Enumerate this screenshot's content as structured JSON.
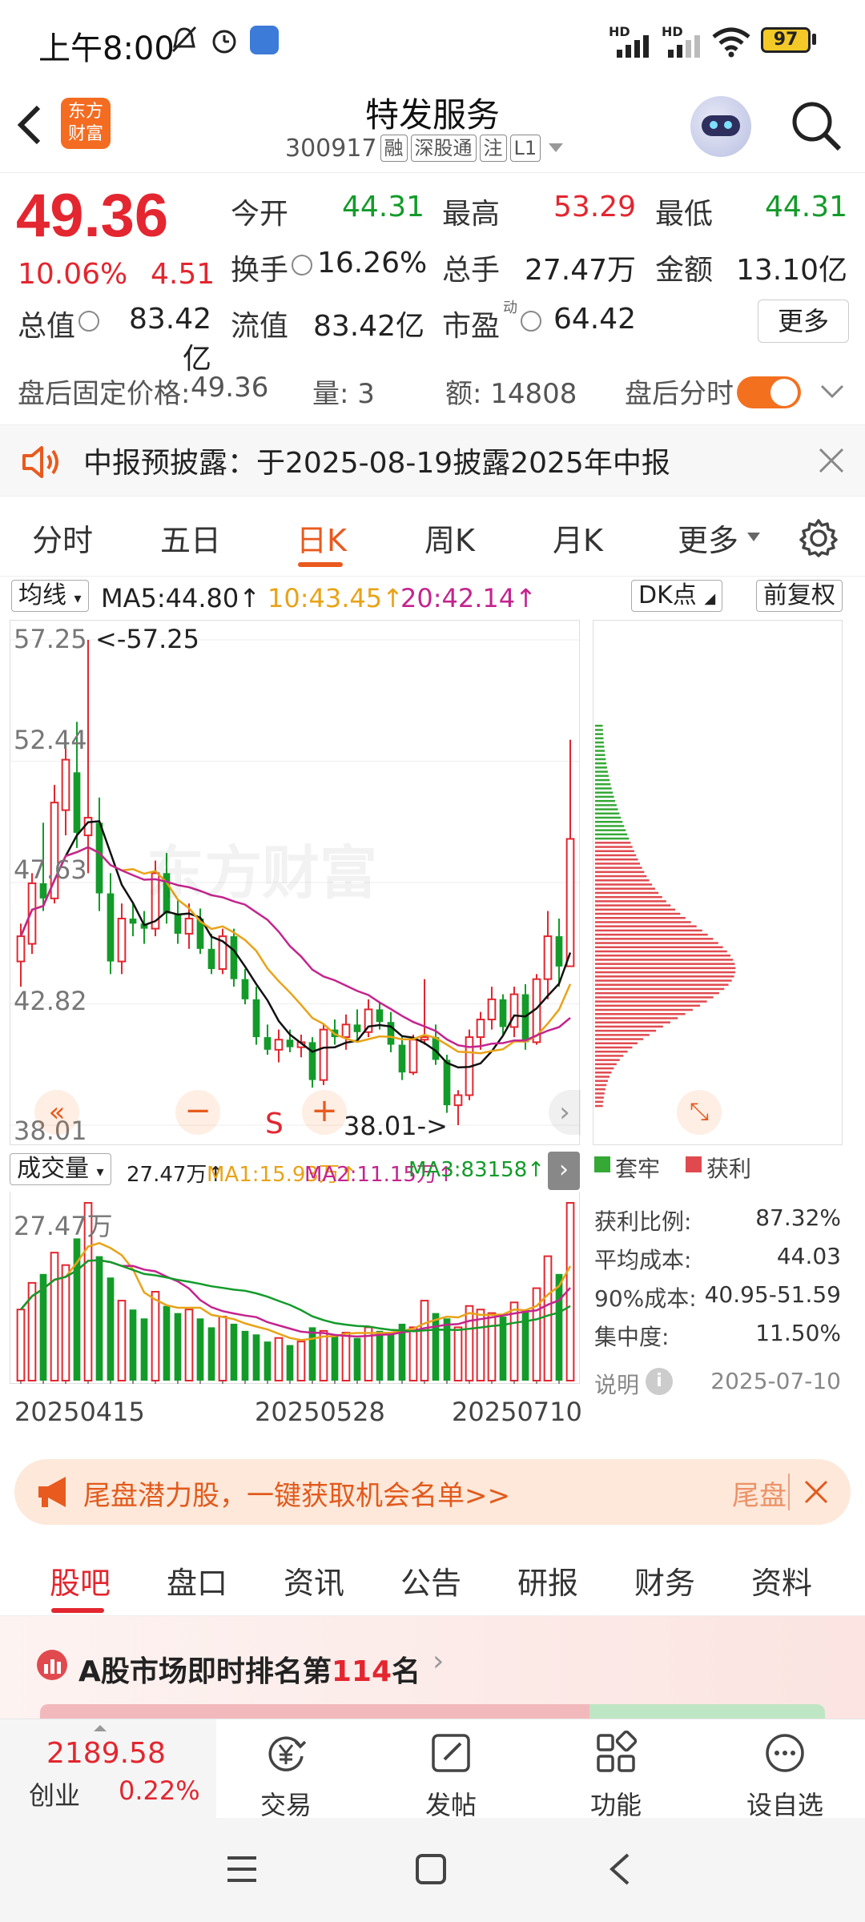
{
  "status_bar": {
    "time": "上午8:00",
    "battery": "97",
    "net_label_1": "HD",
    "net_label_2": "HD"
  },
  "header": {
    "logo_line1": "东方",
    "logo_line2": "财富",
    "stock_name": "特发服务",
    "stock_code": "300917",
    "tags": [
      "融",
      "深股通",
      "注",
      "L1"
    ]
  },
  "quote": {
    "price": "49.36",
    "change_pct": "10.06%",
    "change_amt": "4.51",
    "rows": [
      [
        {
          "label": "今开",
          "value": "44.31",
          "color": "green"
        },
        {
          "label": "最高",
          "value": "53.29",
          "color": "red"
        },
        {
          "label": "最低",
          "value": "44.31",
          "color": "green"
        }
      ],
      [
        {
          "label": "换手",
          "value": "16.26%",
          "color": "dark"
        },
        {
          "label": "总手",
          "value": "27.47万",
          "color": "dark"
        },
        {
          "label": "金额",
          "value": "13.10亿",
          "color": "dark"
        }
      ],
      [
        {
          "label": "总值",
          "value": "83.42亿",
          "color": "dark"
        },
        {
          "label": "流值",
          "value": "83.42亿",
          "color": "dark"
        },
        {
          "label": "市盈",
          "value": "64.42",
          "color": "dark"
        }
      ]
    ],
    "pe_superscript": "动",
    "more_label": "更多"
  },
  "after_hours": {
    "price_label": "盘后固定价格:",
    "price_value": "49.36",
    "volume": "量: 3",
    "amount": "额: 14808",
    "toggle_label": "盘后分时"
  },
  "notice": {
    "text": "中报预披露：于2025-08-19披露2025年中报"
  },
  "period_tabs": [
    "分时",
    "五日",
    "日K",
    "周K",
    "月K",
    "更多"
  ],
  "active_period": "日K",
  "ma_row": {
    "selector": "均线",
    "ma5": "MA5:44.80↑",
    "ma10": "10:43.45↑",
    "ma20": "20:42.14↑",
    "dk_label": "DK点",
    "adjust_label": "前复权"
  },
  "kline": {
    "y_labels": [
      "57.25",
      "52.44",
      "47.63",
      "42.82",
      "38.01"
    ],
    "high_marker": "<-57.25",
    "low_marker": "38.01->",
    "watermark": "东方财富",
    "s_mark": "S"
  },
  "volume_row": {
    "selector": "成交量",
    "vol": "27.47万↑",
    "ma1": "MA1:15.93万↑",
    "ma2": "MA2:11.15万↑",
    "ma3": "MA3:83158↑",
    "y_label": "27.47万"
  },
  "dates": [
    "20250415",
    "20250528",
    "20250710"
  ],
  "chips": {
    "legend_trapped": "套牢",
    "legend_profit": "获利",
    "stats": [
      {
        "label": "获利比例:",
        "value": "87.32%"
      },
      {
        "label": "平均成本:",
        "value": "44.03"
      },
      {
        "label": "90%成本:",
        "value": "40.95-51.59"
      },
      {
        "label": "集中度:",
        "value": "11.50%"
      }
    ],
    "explain_label": "说明",
    "date": "2025-07-10"
  },
  "banner": {
    "text": "尾盘潜力股，一键获取机会名单>>",
    "tail": "尾盘"
  },
  "bottom_tabs": [
    "股吧",
    "盘口",
    "资讯",
    "公告",
    "研报",
    "财务",
    "资料"
  ],
  "rank": {
    "prefix": "A股市场即时排名第",
    "rank": "114",
    "suffix": "名"
  },
  "toolbar": {
    "index_value": "2189.58",
    "index_name": "创业",
    "index_change": "0.22%",
    "items": [
      "交易",
      "发帖",
      "功能",
      "设自选"
    ]
  },
  "chart_data": {
    "type": "candlestick",
    "ylim": [
      38.01,
      57.25
    ],
    "y_ticks": [
      57.25,
      52.44,
      47.63,
      42.82,
      38.01
    ],
    "x_ticks": [
      "20250415",
      "20250528",
      "20250710"
    ],
    "candles": [
      [
        44.5,
        46.0,
        43.5,
        45.5
      ],
      [
        45.2,
        48.0,
        44.8,
        47.6
      ],
      [
        47.6,
        50.0,
        46.5,
        47.0
      ],
      [
        47.0,
        51.5,
        46.8,
        50.8
      ],
      [
        50.5,
        53.2,
        49.5,
        52.5
      ],
      [
        52.0,
        54.0,
        49.0,
        49.6
      ],
      [
        49.5,
        57.25,
        48.0,
        50.2
      ],
      [
        50.0,
        51.0,
        46.5,
        47.2
      ],
      [
        47.2,
        48.0,
        44.0,
        44.5
      ],
      [
        44.5,
        46.8,
        44.0,
        46.2
      ],
      [
        46.2,
        46.8,
        45.5,
        46.0
      ],
      [
        46.0,
        46.5,
        45.2,
        45.8
      ],
      [
        45.8,
        48.5,
        45.5,
        48.0
      ],
      [
        48.0,
        48.8,
        46.0,
        46.4
      ],
      [
        46.4,
        47.0,
        45.2,
        45.6
      ],
      [
        45.6,
        46.8,
        45.0,
        46.2
      ],
      [
        46.2,
        46.6,
        44.8,
        45.0
      ],
      [
        45.0,
        45.6,
        44.0,
        44.2
      ],
      [
        44.2,
        45.8,
        44.0,
        45.5
      ],
      [
        45.5,
        45.8,
        43.5,
        43.8
      ],
      [
        43.8,
        44.2,
        42.8,
        43.0
      ],
      [
        43.0,
        43.5,
        41.2,
        41.5
      ],
      [
        41.5,
        42.0,
        40.8,
        41.0
      ],
      [
        41.0,
        41.8,
        40.5,
        41.4
      ],
      [
        41.4,
        41.8,
        40.9,
        41.1
      ],
      [
        41.1,
        41.6,
        40.7,
        41.3
      ],
      [
        41.3,
        41.5,
        39.5,
        39.8
      ],
      [
        39.8,
        42.0,
        39.6,
        41.8
      ],
      [
        41.8,
        42.2,
        41.2,
        41.5
      ],
      [
        41.5,
        42.4,
        41.0,
        42.0
      ],
      [
        42.0,
        42.6,
        41.4,
        41.7
      ],
      [
        41.7,
        43.0,
        41.5,
        42.6
      ],
      [
        42.6,
        42.9,
        41.8,
        42.1
      ],
      [
        42.1,
        42.5,
        40.9,
        41.2
      ],
      [
        41.2,
        41.5,
        39.8,
        40.1
      ],
      [
        40.1,
        41.6,
        40.0,
        41.4
      ],
      [
        41.4,
        43.8,
        41.2,
        41.5
      ],
      [
        41.5,
        42.0,
        40.4,
        40.6
      ],
      [
        40.6,
        40.8,
        38.5,
        38.8
      ],
      [
        38.8,
        39.4,
        38.01,
        39.2
      ],
      [
        39.2,
        41.8,
        39.0,
        41.5
      ],
      [
        41.5,
        42.5,
        41.0,
        42.2
      ],
      [
        42.2,
        43.5,
        41.8,
        43.0
      ],
      [
        43.0,
        43.2,
        41.6,
        41.9
      ],
      [
        41.9,
        43.5,
        41.5,
        43.2
      ],
      [
        43.2,
        43.6,
        41.0,
        41.3
      ],
      [
        41.3,
        44.0,
        41.2,
        43.8
      ],
      [
        43.8,
        46.5,
        43.0,
        45.5
      ],
      [
        45.5,
        46.2,
        43.5,
        44.3
      ],
      [
        44.31,
        53.29,
        44.31,
        49.36
      ]
    ],
    "volume": [
      40,
      55,
      60,
      72,
      65,
      80,
      100,
      70,
      58,
      45,
      40,
      35,
      50,
      42,
      38,
      40,
      35,
      30,
      36,
      32,
      28,
      26,
      22,
      24,
      20,
      22,
      30,
      28,
      25,
      27,
      24,
      30,
      28,
      26,
      32,
      30,
      45,
      38,
      35,
      30,
      42,
      40,
      38,
      36,
      44,
      40,
      52,
      70,
      60,
      100
    ],
    "ma_legend": {
      "MA5": 44.8,
      "MA10": 43.45,
      "MA20": 42.14
    }
  }
}
